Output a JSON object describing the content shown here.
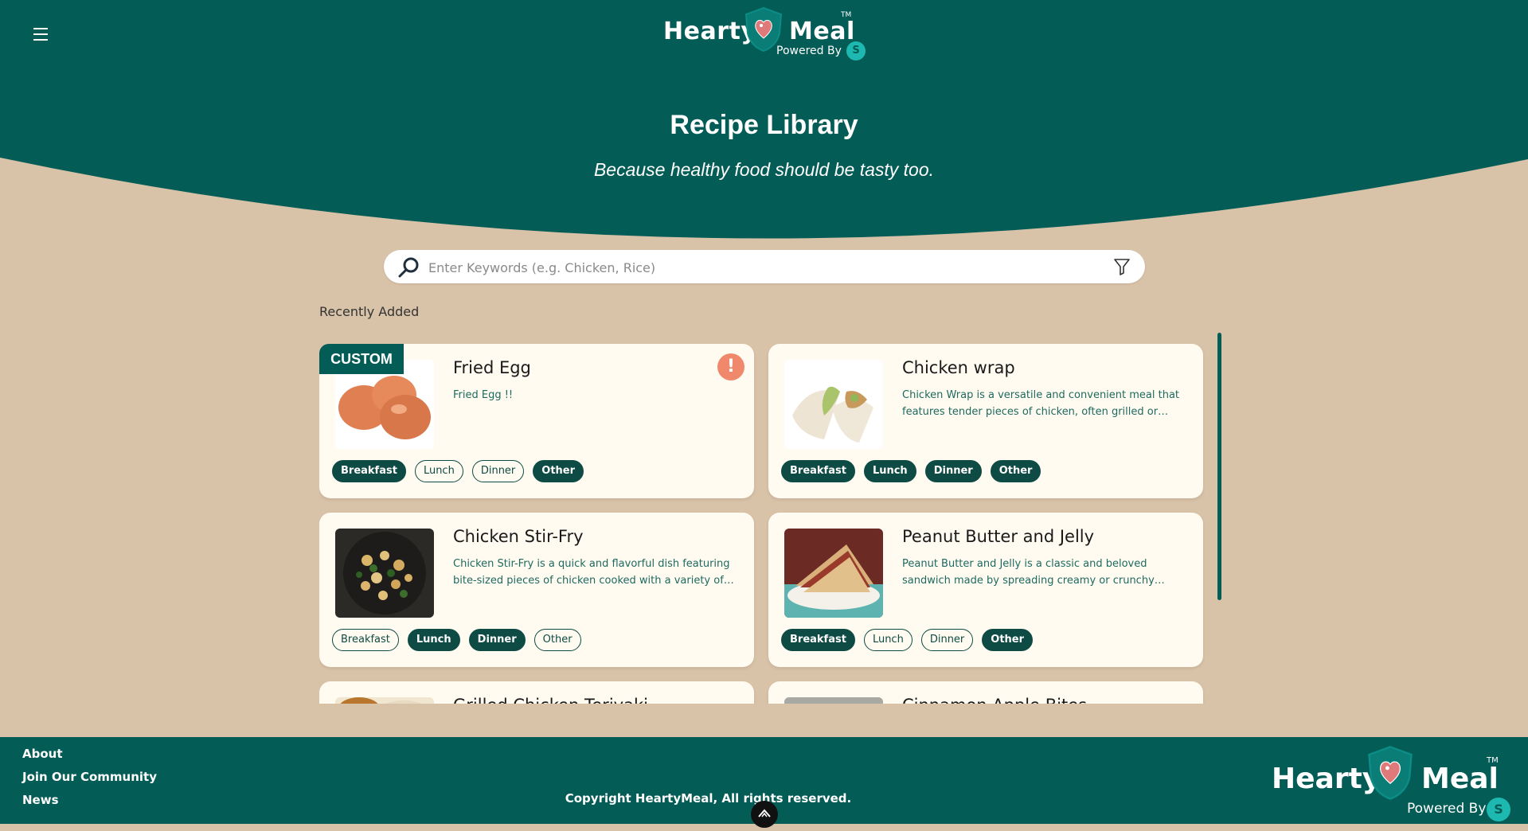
{
  "header": {
    "brand_word1": "Hearty",
    "brand_word2": "Meal",
    "trademark": "TM",
    "powered_by": "Powered By",
    "powered_badge": "S"
  },
  "hero": {
    "title": "Recipe Library",
    "tagline": "Because healthy food should be tasty too."
  },
  "search": {
    "placeholder": "Enter Keywords (e.g. Chicken, Rice)"
  },
  "section_label": "Recently Added",
  "recipes": [
    {
      "title": "Fried Egg",
      "description": "Fried Egg !!",
      "badge": "CUSTOM",
      "alert": "!",
      "tags": [
        {
          "label": "Breakfast",
          "active": true
        },
        {
          "label": "Lunch",
          "active": false
        },
        {
          "label": "Dinner",
          "active": false
        },
        {
          "label": "Other",
          "active": true
        }
      ]
    },
    {
      "title": "Chicken wrap",
      "description": "Chicken Wrap is a versatile and convenient meal that features tender pieces of chicken, often grilled or…",
      "tags": [
        {
          "label": "Breakfast",
          "active": true
        },
        {
          "label": "Lunch",
          "active": true
        },
        {
          "label": "Dinner",
          "active": true
        },
        {
          "label": "Other",
          "active": true
        }
      ]
    },
    {
      "title": "Chicken Stir-Fry",
      "description": "Chicken Stir-Fry is a quick and flavorful dish featuring bite-sized pieces of chicken cooked with a variety of…",
      "tags": [
        {
          "label": "Breakfast",
          "active": false
        },
        {
          "label": "Lunch",
          "active": true
        },
        {
          "label": "Dinner",
          "active": true
        },
        {
          "label": "Other",
          "active": false
        }
      ]
    },
    {
      "title": "Peanut Butter and Jelly",
      "description": "Peanut Butter and Jelly is a classic and beloved sandwich made by spreading creamy or crunchy pean…",
      "tags": [
        {
          "label": "Breakfast",
          "active": true
        },
        {
          "label": "Lunch",
          "active": false
        },
        {
          "label": "Dinner",
          "active": false
        },
        {
          "label": "Other",
          "active": true
        }
      ]
    },
    {
      "title": "Grilled Chicken Teriyaki",
      "description": "",
      "tags": []
    },
    {
      "title": "Cinnamon Apple Bites",
      "description": "",
      "tags": []
    }
  ],
  "footer": {
    "links": [
      "About",
      "Join Our Community",
      "News"
    ],
    "copyright": "Copyright HeartyMeal, All rights reserved."
  },
  "colors": {
    "primary": "#045c57",
    "background": "#d8c2a8",
    "card": "#fffbf0",
    "alert": "#f0896c",
    "accent": "#1db9b0"
  }
}
